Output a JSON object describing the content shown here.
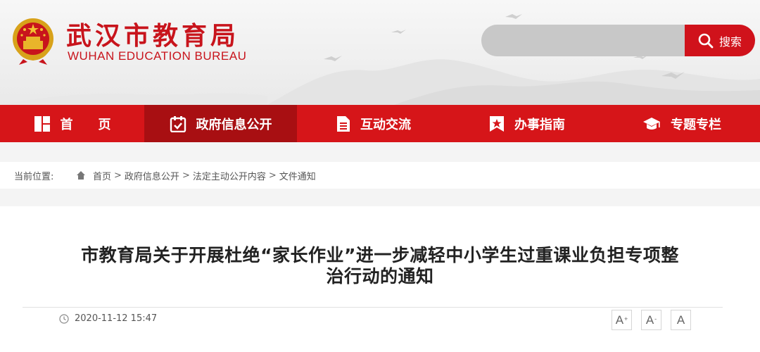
{
  "header": {
    "title_cn": "武汉市教育局",
    "title_en": "WUHAN EDUCATION BUREAU",
    "search_button": "搜索",
    "search_value": ""
  },
  "nav": [
    {
      "label": "首　　页",
      "icon": "grid-icon"
    },
    {
      "label": "政府信息公开",
      "icon": "calendar-check-icon",
      "active": true
    },
    {
      "label": "互动交流",
      "icon": "document-icon"
    },
    {
      "label": "办事指南",
      "icon": "bookmark-star-icon"
    },
    {
      "label": "专题专栏",
      "icon": "graduation-cap-icon"
    }
  ],
  "breadcrumb": {
    "label": "当前位置:",
    "items": [
      "首页",
      "政府信息公开",
      "法定主动公开内容",
      "文件通知"
    ],
    "separator": ">"
  },
  "article": {
    "title_line1": "市教育局关于开展杜绝“家长作业”进一步减轻中小学生过重课业负担专项整",
    "title_line2": "治行动的通知",
    "date": "2020-11-12 15:47",
    "font_large": "A",
    "font_small": "A",
    "font_reset": "A",
    "font_large_sup": "+",
    "font_small_sup": "-"
  },
  "colors": {
    "brand_red": "#d61519",
    "nav_active": "#a80f12",
    "search_button": "#d0121b"
  }
}
